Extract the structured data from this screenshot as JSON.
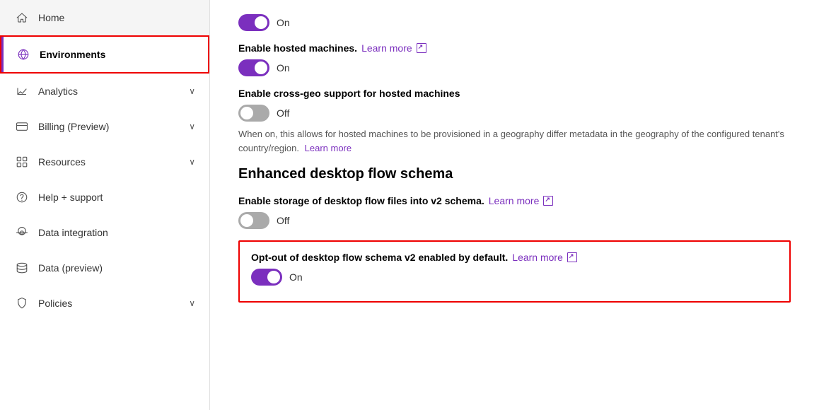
{
  "sidebar": {
    "items": [
      {
        "id": "home",
        "label": "Home",
        "icon": "home-icon",
        "hasChevron": false,
        "active": false
      },
      {
        "id": "environments",
        "label": "Environments",
        "icon": "globe-icon",
        "hasChevron": false,
        "active": true
      },
      {
        "id": "analytics",
        "label": "Analytics",
        "icon": "analytics-icon",
        "hasChevron": true,
        "active": false
      },
      {
        "id": "billing",
        "label": "Billing (Preview)",
        "icon": "billing-icon",
        "hasChevron": true,
        "active": false
      },
      {
        "id": "resources",
        "label": "Resources",
        "icon": "resources-icon",
        "hasChevron": true,
        "active": false
      },
      {
        "id": "help",
        "label": "Help + support",
        "icon": "help-icon",
        "hasChevron": false,
        "active": false
      },
      {
        "id": "data-integration",
        "label": "Data integration",
        "icon": "data-integration-icon",
        "hasChevron": false,
        "active": false
      },
      {
        "id": "data-preview",
        "label": "Data (preview)",
        "icon": "data-preview-icon",
        "hasChevron": false,
        "active": false
      },
      {
        "id": "policies",
        "label": "Policies",
        "icon": "policies-icon",
        "hasChevron": true,
        "active": false
      }
    ]
  },
  "main": {
    "settings": [
      {
        "id": "toggle-top",
        "label": "",
        "toggleState": "on",
        "toggleLabel": "On",
        "hasLink": false
      },
      {
        "id": "hosted-machines",
        "label": "Enable hosted machines.",
        "linkText": "Learn more",
        "toggleState": "on",
        "toggleLabel": "On",
        "hasLink": true
      },
      {
        "id": "cross-geo",
        "label": "Enable cross-geo support for hosted machines",
        "toggleState": "off",
        "toggleLabel": "Off",
        "hasLink": false
      }
    ],
    "crossGeoDescription": "When on, this allows for hosted machines to be provisioned in a geography differ metadata in the geography of the configured tenant's country/region.",
    "crossGeoLinkText": "Learn more",
    "sectionTitle": "Enhanced desktop flow schema",
    "desktopFlowSettings": [
      {
        "id": "storage-v2",
        "label": "Enable storage of desktop flow files into v2 schema.",
        "linkText": "Learn more",
        "toggleState": "off",
        "toggleLabel": "Off",
        "hasLink": true,
        "highlighted": false
      },
      {
        "id": "opt-out-v2",
        "label": "Opt-out of desktop flow schema v2 enabled by default.",
        "linkText": "Learn more",
        "toggleState": "on",
        "toggleLabel": "On",
        "hasLink": true,
        "highlighted": true
      }
    ]
  }
}
